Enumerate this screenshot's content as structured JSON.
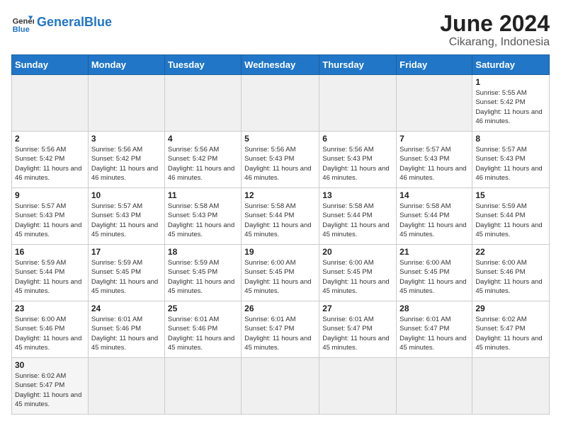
{
  "header": {
    "logo_general": "General",
    "logo_blue": "Blue",
    "month": "June 2024",
    "location": "Cikarang, Indonesia"
  },
  "weekdays": [
    "Sunday",
    "Monday",
    "Tuesday",
    "Wednesday",
    "Thursday",
    "Friday",
    "Saturday"
  ],
  "days": {
    "1": {
      "sunrise": "5:55 AM",
      "sunset": "5:42 PM",
      "daylight": "11 hours and 46 minutes."
    },
    "2": {
      "sunrise": "5:56 AM",
      "sunset": "5:42 PM",
      "daylight": "11 hours and 46 minutes."
    },
    "3": {
      "sunrise": "5:56 AM",
      "sunset": "5:42 PM",
      "daylight": "11 hours and 46 minutes."
    },
    "4": {
      "sunrise": "5:56 AM",
      "sunset": "5:42 PM",
      "daylight": "11 hours and 46 minutes."
    },
    "5": {
      "sunrise": "5:56 AM",
      "sunset": "5:43 PM",
      "daylight": "11 hours and 46 minutes."
    },
    "6": {
      "sunrise": "5:56 AM",
      "sunset": "5:43 PM",
      "daylight": "11 hours and 46 minutes."
    },
    "7": {
      "sunrise": "5:57 AM",
      "sunset": "5:43 PM",
      "daylight": "11 hours and 46 minutes."
    },
    "8": {
      "sunrise": "5:57 AM",
      "sunset": "5:43 PM",
      "daylight": "11 hours and 46 minutes."
    },
    "9": {
      "sunrise": "5:57 AM",
      "sunset": "5:43 PM",
      "daylight": "11 hours and 45 minutes."
    },
    "10": {
      "sunrise": "5:57 AM",
      "sunset": "5:43 PM",
      "daylight": "11 hours and 45 minutes."
    },
    "11": {
      "sunrise": "5:58 AM",
      "sunset": "5:43 PM",
      "daylight": "11 hours and 45 minutes."
    },
    "12": {
      "sunrise": "5:58 AM",
      "sunset": "5:44 PM",
      "daylight": "11 hours and 45 minutes."
    },
    "13": {
      "sunrise": "5:58 AM",
      "sunset": "5:44 PM",
      "daylight": "11 hours and 45 minutes."
    },
    "14": {
      "sunrise": "5:58 AM",
      "sunset": "5:44 PM",
      "daylight": "11 hours and 45 minutes."
    },
    "15": {
      "sunrise": "5:59 AM",
      "sunset": "5:44 PM",
      "daylight": "11 hours and 45 minutes."
    },
    "16": {
      "sunrise": "5:59 AM",
      "sunset": "5:44 PM",
      "daylight": "11 hours and 45 minutes."
    },
    "17": {
      "sunrise": "5:59 AM",
      "sunset": "5:45 PM",
      "daylight": "11 hours and 45 minutes."
    },
    "18": {
      "sunrise": "5:59 AM",
      "sunset": "5:45 PM",
      "daylight": "11 hours and 45 minutes."
    },
    "19": {
      "sunrise": "6:00 AM",
      "sunset": "5:45 PM",
      "daylight": "11 hours and 45 minutes."
    },
    "20": {
      "sunrise": "6:00 AM",
      "sunset": "5:45 PM",
      "daylight": "11 hours and 45 minutes."
    },
    "21": {
      "sunrise": "6:00 AM",
      "sunset": "5:45 PM",
      "daylight": "11 hours and 45 minutes."
    },
    "22": {
      "sunrise": "6:00 AM",
      "sunset": "5:46 PM",
      "daylight": "11 hours and 45 minutes."
    },
    "23": {
      "sunrise": "6:00 AM",
      "sunset": "5:46 PM",
      "daylight": "11 hours and 45 minutes."
    },
    "24": {
      "sunrise": "6:01 AM",
      "sunset": "5:46 PM",
      "daylight": "11 hours and 45 minutes."
    },
    "25": {
      "sunrise": "6:01 AM",
      "sunset": "5:46 PM",
      "daylight": "11 hours and 45 minutes."
    },
    "26": {
      "sunrise": "6:01 AM",
      "sunset": "5:47 PM",
      "daylight": "11 hours and 45 minutes."
    },
    "27": {
      "sunrise": "6:01 AM",
      "sunset": "5:47 PM",
      "daylight": "11 hours and 45 minutes."
    },
    "28": {
      "sunrise": "6:01 AM",
      "sunset": "5:47 PM",
      "daylight": "11 hours and 45 minutes."
    },
    "29": {
      "sunrise": "6:02 AM",
      "sunset": "5:47 PM",
      "daylight": "11 hours and 45 minutes."
    },
    "30": {
      "sunrise": "6:02 AM",
      "sunset": "5:47 PM",
      "daylight": "11 hours and 45 minutes."
    }
  },
  "labels": {
    "sunrise": "Sunrise:",
    "sunset": "Sunset:",
    "daylight": "Daylight:"
  }
}
